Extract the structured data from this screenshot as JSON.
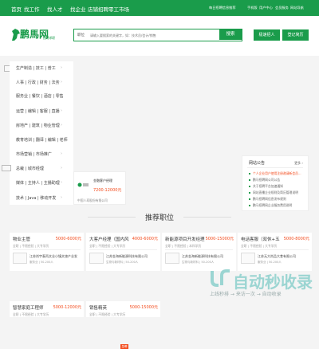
{
  "topnav": {
    "items": [
      "首页",
      "找工作",
      "找人才",
      "找企业",
      "店铺招聘",
      "零工市场"
    ],
    "right": [
      "每日招聘信息推荐",
      "手机版",
      "用户中心",
      "会员服务",
      "网站导航"
    ]
  },
  "header": {
    "logo_text": "鹏馬网",
    "logo_sub": "招聘求职",
    "search_type": "职位",
    "search_placeholder": "请输入要搜索的关键字，如：技术员/会计/销售",
    "search_button": "搜索",
    "btn_register": "极速招人",
    "btn_login": "登记简历"
  },
  "sidebar": {
    "categories": [
      "生产制造 | 技工 | 普工",
      "人事 | 行政 | 财务 | 法务",
      "服务业 | 餐饮 | 酒店 | 零售",
      "运营 | 编辑 | 客服 | 直播",
      "房地产 | 建筑 | 物业管理",
      "教育培训 | 翻译 | 编辑 | 老师",
      "市场营销 | 市场推广",
      "总裁 | 城市经理",
      "媒体 | 主持人 | 主播助理",
      "技术 | Java | 移动开发"
    ],
    "chevron": "›"
  },
  "card": {
    "title": "金融客户经理",
    "salary": "7200-12000元",
    "company": "中国人寿股份有限公司",
    "badge": "急聘"
  },
  "notice": {
    "title": "网站公告",
    "more": "更多 ›",
    "items": [
      "个人企业用户使用注册邀请新会员...",
      "鹏马招聘网公司公告",
      "关于招聘平台加速通知",
      "网站直播企业规则及简历管理说明",
      "鹏马招聘网信息发布规则",
      "鹏马招聘网企业服务费用说明"
    ]
  },
  "recommend": {
    "title": "推荐职位",
    "jobs": [
      {
        "title": "物业主管",
        "salary": "5000-6000元",
        "req": "全职 | 不限经验 | 大专学历",
        "company": "江苏尚宇泰丙文业小镇文旅产业发",
        "sub": "服务业 | 50-200人"
      },
      {
        "title": "大客户经理（国内风",
        "salary": "4000-6000元",
        "req": "全职 | 不限经验 | 大专学历",
        "company": "江苏金海新能源科技有限公司",
        "sub": "生物与新材料 | 50-200人"
      },
      {
        "title": "新能源项目开发经理",
        "salary": "5000-15000元",
        "req": "全职 | 不限经验 | 本科学历",
        "company": "江苏金海新能源科技有限公司",
        "sub": "生物与新材料 | 50-200人"
      },
      {
        "title": "电话客服（双休+五",
        "salary": "5000-8000元",
        "req": "全职 | 不限经验 | 大专学历",
        "company": "江苏无大尚品大食有限公司",
        "sub": "服务业 | 50-200人"
      },
      {
        "title": "智慧家庭工程师",
        "salary": "5000-12000元",
        "req": "全职 | 不限经验 | 大专学历",
        "company": "",
        "sub": ""
      },
      {
        "title": "销售精英",
        "salary": "5000-15000元",
        "req": "全职 | 不限经验 | 大专学历",
        "company": "",
        "sub": ""
      }
    ]
  },
  "watermark": {
    "text": "自动秒收录",
    "sub": "上线秒排 → 来访一次 → 自动收录"
  },
  "colors": {
    "brand": "#1a9c4b",
    "salary": "#f34a1b"
  }
}
